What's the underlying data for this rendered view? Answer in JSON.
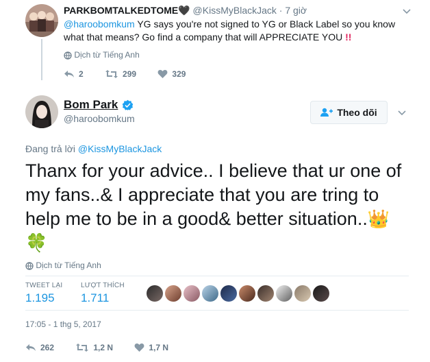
{
  "reply_tweet": {
    "display_name": "PARKBOMTALKEDTOME",
    "handle": "@KissMyBlackJack",
    "time": "7 giờ",
    "mention": "@haroobomkum",
    "text": "YG says you're not signed to YG or Black Label so you know what that means? Go find a company that will APPRECIATE YOU",
    "translate_label": "Dịch từ Tiếng Anh",
    "reply_count": "2",
    "retweet_count": "299",
    "like_count": "329"
  },
  "main_tweet": {
    "display_name": "Bom Park",
    "handle": "@haroobomkum",
    "follow_label": "Theo dõi",
    "replying_prefix": "Đang trả lời",
    "replying_handle": "@KissMyBlackJack",
    "text": "Thanx for your advice.. I believe that ur one of my fans..& I appreciate that you are tring to help me to be in a good& better situation..",
    "emoji_crown": "👑",
    "emoji_clover": "🍀",
    "translate_label": "Dịch từ Tiếng Anh",
    "retweets_label": "TWEET LẠI",
    "retweets_value": "1.195",
    "likes_label": "LƯỢT THÍCH",
    "likes_value": "1.711",
    "timestamp": "17:05 - 1 thg 5, 2017",
    "reply_count": "262",
    "retweet_count": "1,2 N",
    "like_count": "1,7 N"
  },
  "colors": {
    "accent": "#1b95e0",
    "muted": "#657786",
    "emoji_red": "#e0245e"
  }
}
